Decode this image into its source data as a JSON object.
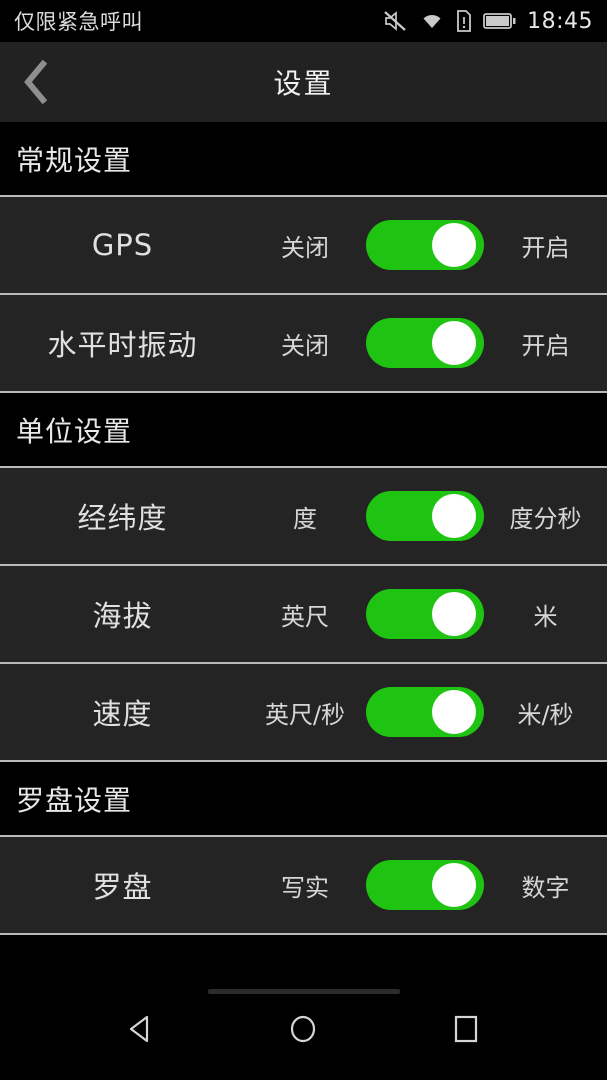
{
  "statusbar": {
    "carrier": "仅限紧急呼叫",
    "time": "18:45",
    "icons": [
      "mute-icon",
      "wifi-icon",
      "sim-card-alert-icon",
      "battery-icon"
    ]
  },
  "header": {
    "title": "设置",
    "back_label": "back-chevron"
  },
  "sections": [
    {
      "title": "常规设置",
      "rows": [
        {
          "label": "GPS",
          "left": "关闭",
          "right": "开启",
          "state": "right"
        },
        {
          "label": "水平时振动",
          "left": "关闭",
          "right": "开启",
          "state": "right"
        }
      ]
    },
    {
      "title": "单位设置",
      "rows": [
        {
          "label": "经纬度",
          "left": "度",
          "right": "度分秒",
          "state": "right"
        },
        {
          "label": "海拔",
          "left": "英尺",
          "right": "米",
          "state": "right"
        },
        {
          "label": "速度",
          "left": "英尺/秒",
          "right": "米/秒",
          "state": "right"
        }
      ]
    },
    {
      "title": "罗盘设置",
      "rows": [
        {
          "label": "罗盘",
          "left": "写实",
          "right": "数字",
          "state": "right"
        }
      ]
    }
  ],
  "navbar": {
    "back": "back-triangle",
    "home": "home-circle",
    "recents": "recents-square"
  },
  "colors": {
    "accent_green": "#1fc412",
    "row_bg": "#242424",
    "section_bg": "#000000",
    "header_bg": "#222222",
    "divider": "#b9b9b9",
    "text": "#e0e0e0"
  }
}
